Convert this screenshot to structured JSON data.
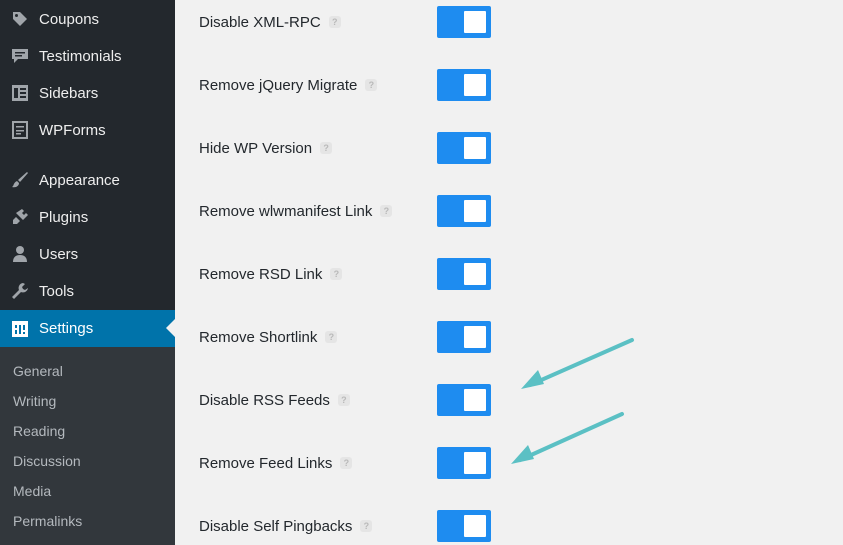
{
  "sidebar": {
    "items": [
      {
        "label": "Coupons",
        "icon": "tag-icon"
      },
      {
        "label": "Testimonials",
        "icon": "comment-icon"
      },
      {
        "label": "Sidebars",
        "icon": "sidebars-icon"
      },
      {
        "label": "WPForms",
        "icon": "form-icon"
      },
      {
        "label": "Appearance",
        "icon": "paintbrush-icon"
      },
      {
        "label": "Plugins",
        "icon": "plug-icon"
      },
      {
        "label": "Users",
        "icon": "user-icon"
      },
      {
        "label": "Tools",
        "icon": "wrench-icon"
      },
      {
        "label": "Settings",
        "icon": "settings-icon",
        "active": true
      }
    ],
    "submenu": [
      "General",
      "Writing",
      "Reading",
      "Discussion",
      "Media",
      "Permalinks"
    ]
  },
  "settings": {
    "help_glyph": "?",
    "rows": [
      {
        "label": "Disable XML-RPC",
        "enabled": true
      },
      {
        "label": "Remove jQuery Migrate",
        "enabled": true
      },
      {
        "label": "Hide WP Version",
        "enabled": true
      },
      {
        "label": "Remove wlwmanifest Link",
        "enabled": true
      },
      {
        "label": "Remove RSD Link",
        "enabled": true
      },
      {
        "label": "Remove Shortlink",
        "enabled": true
      },
      {
        "label": "Disable RSS Feeds",
        "enabled": true
      },
      {
        "label": "Remove Feed Links",
        "enabled": true
      },
      {
        "label": "Disable Self Pingbacks",
        "enabled": true
      }
    ]
  },
  "colors": {
    "sidebar_bg": "#23282d",
    "active_bg": "#0073aa",
    "toggle_on": "#1e8cf0",
    "annotation_arrow": "#5bc0c4"
  }
}
